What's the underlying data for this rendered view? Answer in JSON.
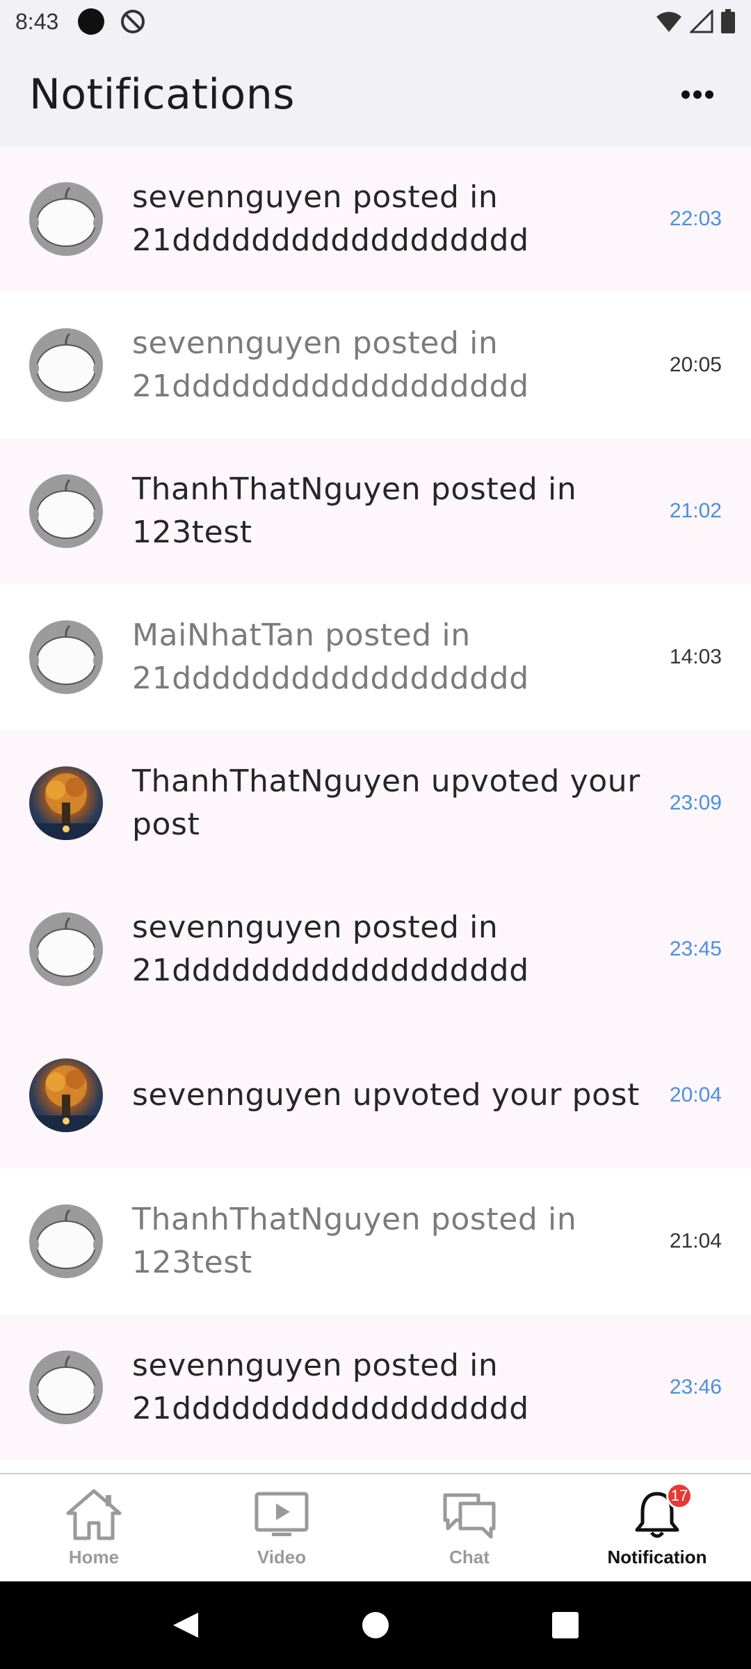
{
  "status_bar": {
    "time": "8:43"
  },
  "header": {
    "title": "Notifications",
    "more_icon": "more-horizontal-icon"
  },
  "notifications": [
    {
      "text": "sevennguyen posted in 21dddddddddddddddddd",
      "time": "22:03",
      "read": false,
      "avatar": "robot-avatar"
    },
    {
      "text": "sevennguyen posted in 21dddddddddddddddddd",
      "time": "20:05",
      "read": true,
      "avatar": "robot-avatar"
    },
    {
      "text": "ThanhThatNguyen posted in 123test",
      "time": "21:02",
      "read": false,
      "avatar": "robot-avatar"
    },
    {
      "text": "MaiNhatTan posted in 21dddddddddddddddddd",
      "time": "14:03",
      "read": true,
      "avatar": "robot-avatar"
    },
    {
      "text": "ThanhThatNguyen upvoted your post",
      "time": "23:09",
      "read": false,
      "avatar": "tree-avatar"
    },
    {
      "text": "sevennguyen posted in 21dddddddddddddddddd",
      "time": "23:45",
      "read": false,
      "avatar": "robot-avatar"
    },
    {
      "text": "sevennguyen upvoted your post",
      "time": "20:04",
      "read": false,
      "avatar": "tree-avatar"
    },
    {
      "text": "ThanhThatNguyen posted in 123test",
      "time": "21:04",
      "read": true,
      "avatar": "robot-avatar"
    },
    {
      "text": "sevennguyen posted in 21dddddddddddddddddd",
      "time": "23:46",
      "read": false,
      "avatar": "robot-avatar"
    }
  ],
  "bottom_nav": {
    "items": [
      {
        "label": "Home",
        "icon": "home-icon",
        "active": false
      },
      {
        "label": "Video",
        "icon": "video-icon",
        "active": false
      },
      {
        "label": "Chat",
        "icon": "chat-icon",
        "active": false
      },
      {
        "label": "Notification",
        "icon": "bell-icon",
        "active": true,
        "badge": "17"
      }
    ]
  },
  "colors": {
    "unread_time": "#4a8fe0",
    "unread_bg": "#fdf7fc",
    "badge": "#e53935",
    "header_bg": "#f2f1f6"
  }
}
